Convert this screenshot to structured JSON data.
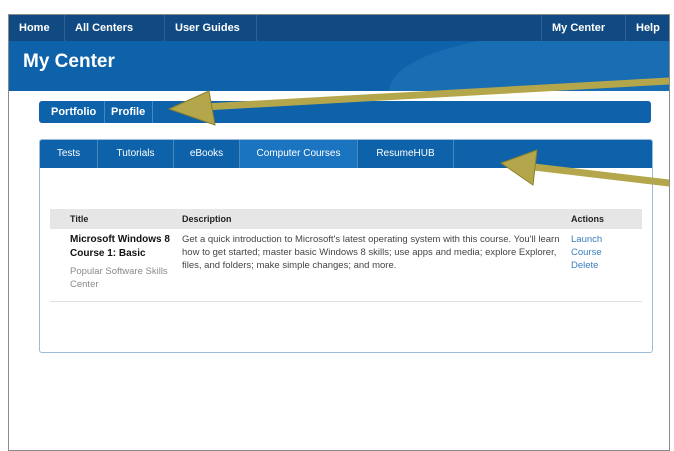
{
  "topnav": {
    "left_items": [
      "Home",
      "All Centers",
      "User Guides"
    ],
    "right_items": [
      "My Center",
      "Help"
    ]
  },
  "header": {
    "title": "My Center"
  },
  "profile_tabs": [
    "Portfolio",
    "Profile"
  ],
  "content_tabs": [
    "Tests",
    "Tutorials",
    "eBooks",
    "Computer Courses",
    "ResumeHUB"
  ],
  "active_content_tab": "Computer Courses",
  "table": {
    "columns": [
      "Title",
      "Description",
      "Actions"
    ],
    "rows": [
      {
        "title": "Microsoft Windows 8 Course 1: Basic",
        "subtitle": "Popular Software Skills Center",
        "description": "Get a quick introduction to Microsoft's latest operating system with this course. You'll learn how to get started; master basic Windows 8 skills; use apps and media; explore Explorer, files, and folders; make simple changes; and more.",
        "actions": [
          "Launch Course",
          "Delete"
        ]
      }
    ]
  },
  "colors": {
    "nav_dark": "#114a82",
    "brand_blue": "#0d62aa",
    "link": "#3a7dbf",
    "arrow": "#b4a64a"
  }
}
